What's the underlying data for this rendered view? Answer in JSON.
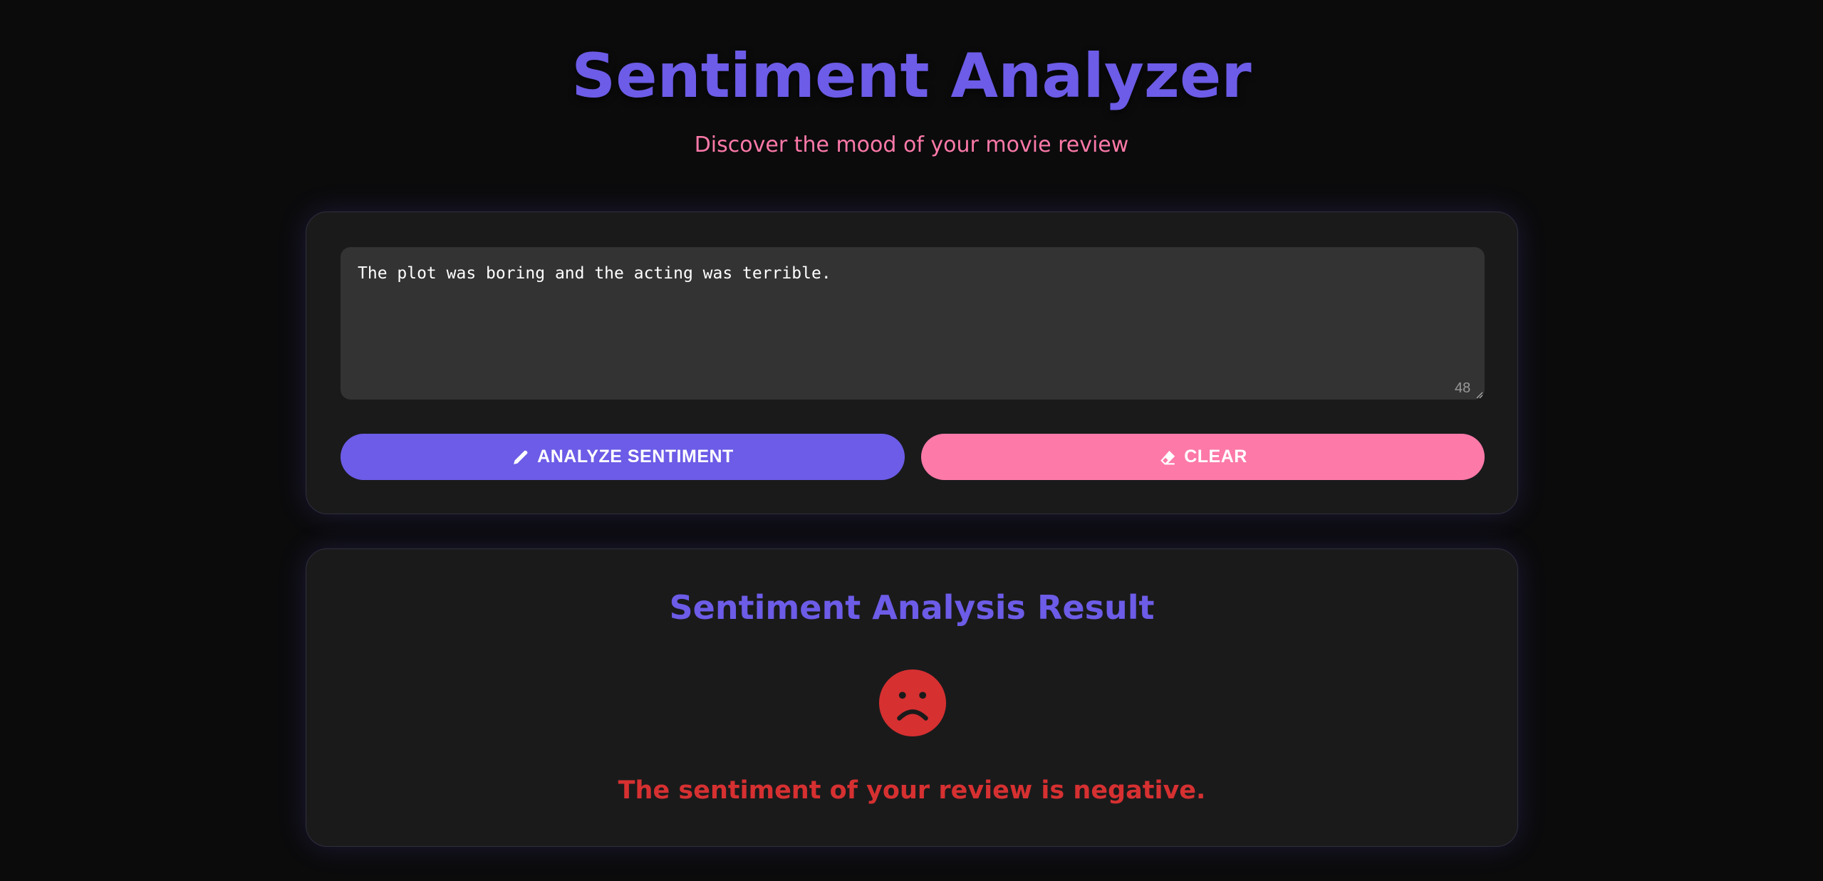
{
  "header": {
    "title": "Sentiment Analyzer",
    "subtitle": "Discover the mood of your movie review"
  },
  "review_form": {
    "review_text": "The plot was boring and the acting was terrible.",
    "char_count": "48",
    "analyze_label": "ANALYZE SENTIMENT",
    "analyze_icon": "pencil-icon",
    "clear_label": "CLEAR",
    "clear_icon": "eraser-icon"
  },
  "result": {
    "title": "Sentiment Analysis Result",
    "mood_icon": "sad-face-icon",
    "message": "The sentiment of your review is negative."
  },
  "colors": {
    "background": "#0b0b0c",
    "card": "#1a1a1b",
    "primary": "#6c5ce7",
    "accent": "#fd79a8",
    "negative": "#d63031",
    "textarea": "#333333"
  }
}
